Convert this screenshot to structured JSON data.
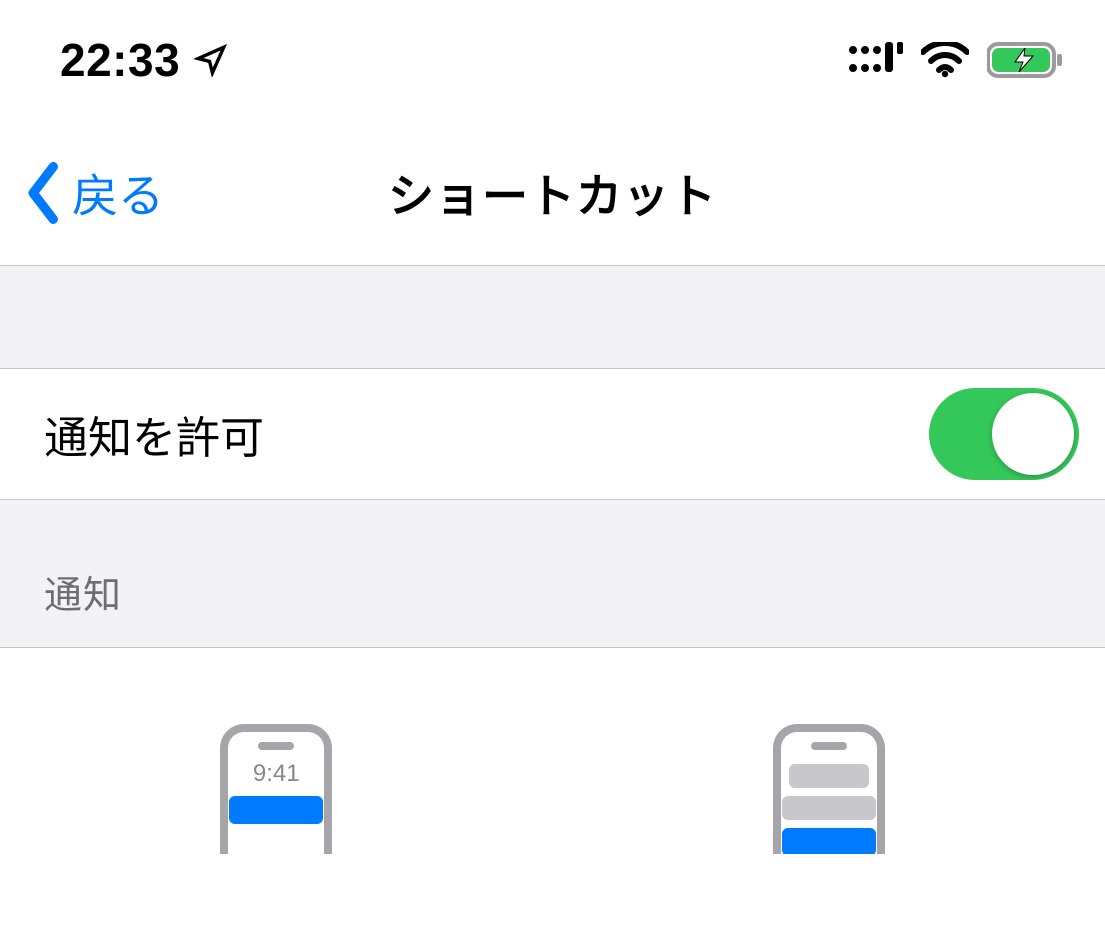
{
  "statusBar": {
    "time": "22:33"
  },
  "nav": {
    "back_label": "戻る",
    "title": "ショートカット"
  },
  "settings": {
    "allow_notifications_label": "通知を許可",
    "allow_notifications_on": true
  },
  "section": {
    "header": "通知"
  },
  "previews": {
    "lock_screen_time": "9:41"
  },
  "colors": {
    "tint": "#007aff",
    "toggle_on": "#34c759"
  }
}
